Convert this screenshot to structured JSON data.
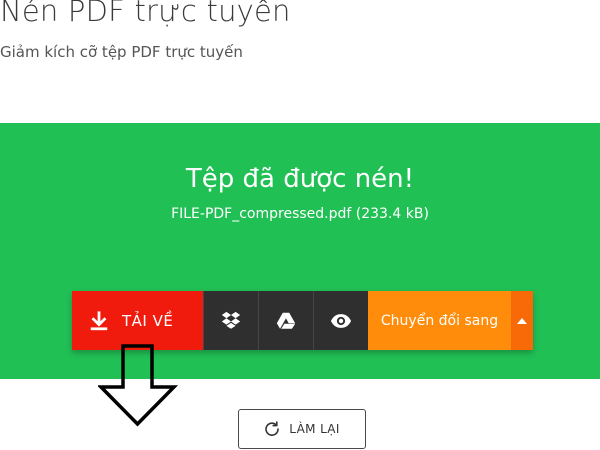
{
  "header": {
    "title": "Nén PDF trực tuyến",
    "subtitle": "Giảm kích cỡ tệp PDF trực tuyến"
  },
  "result": {
    "heading": "Tệp đã được nén!",
    "file_info": "FILE-PDF_compressed.pdf (233.4 kB)"
  },
  "actions": {
    "download_label": "TẢI VỀ",
    "download_icon": "download-icon",
    "dropbox_icon": "dropbox-icon",
    "drive_icon": "google-drive-icon",
    "preview_icon": "eye-icon",
    "convert_label": "Chuyển đổi sang",
    "caret_icon": "caret-up-icon"
  },
  "footer": {
    "redo_label": "LÀM LẠI",
    "redo_icon": "refresh-icon"
  },
  "colors": {
    "panel_green": "#21c055",
    "download_red": "#f11b0d",
    "dark_button": "#2f2f2f",
    "convert_orange": "#ff8c0a",
    "caret_orange": "#f76a07"
  }
}
